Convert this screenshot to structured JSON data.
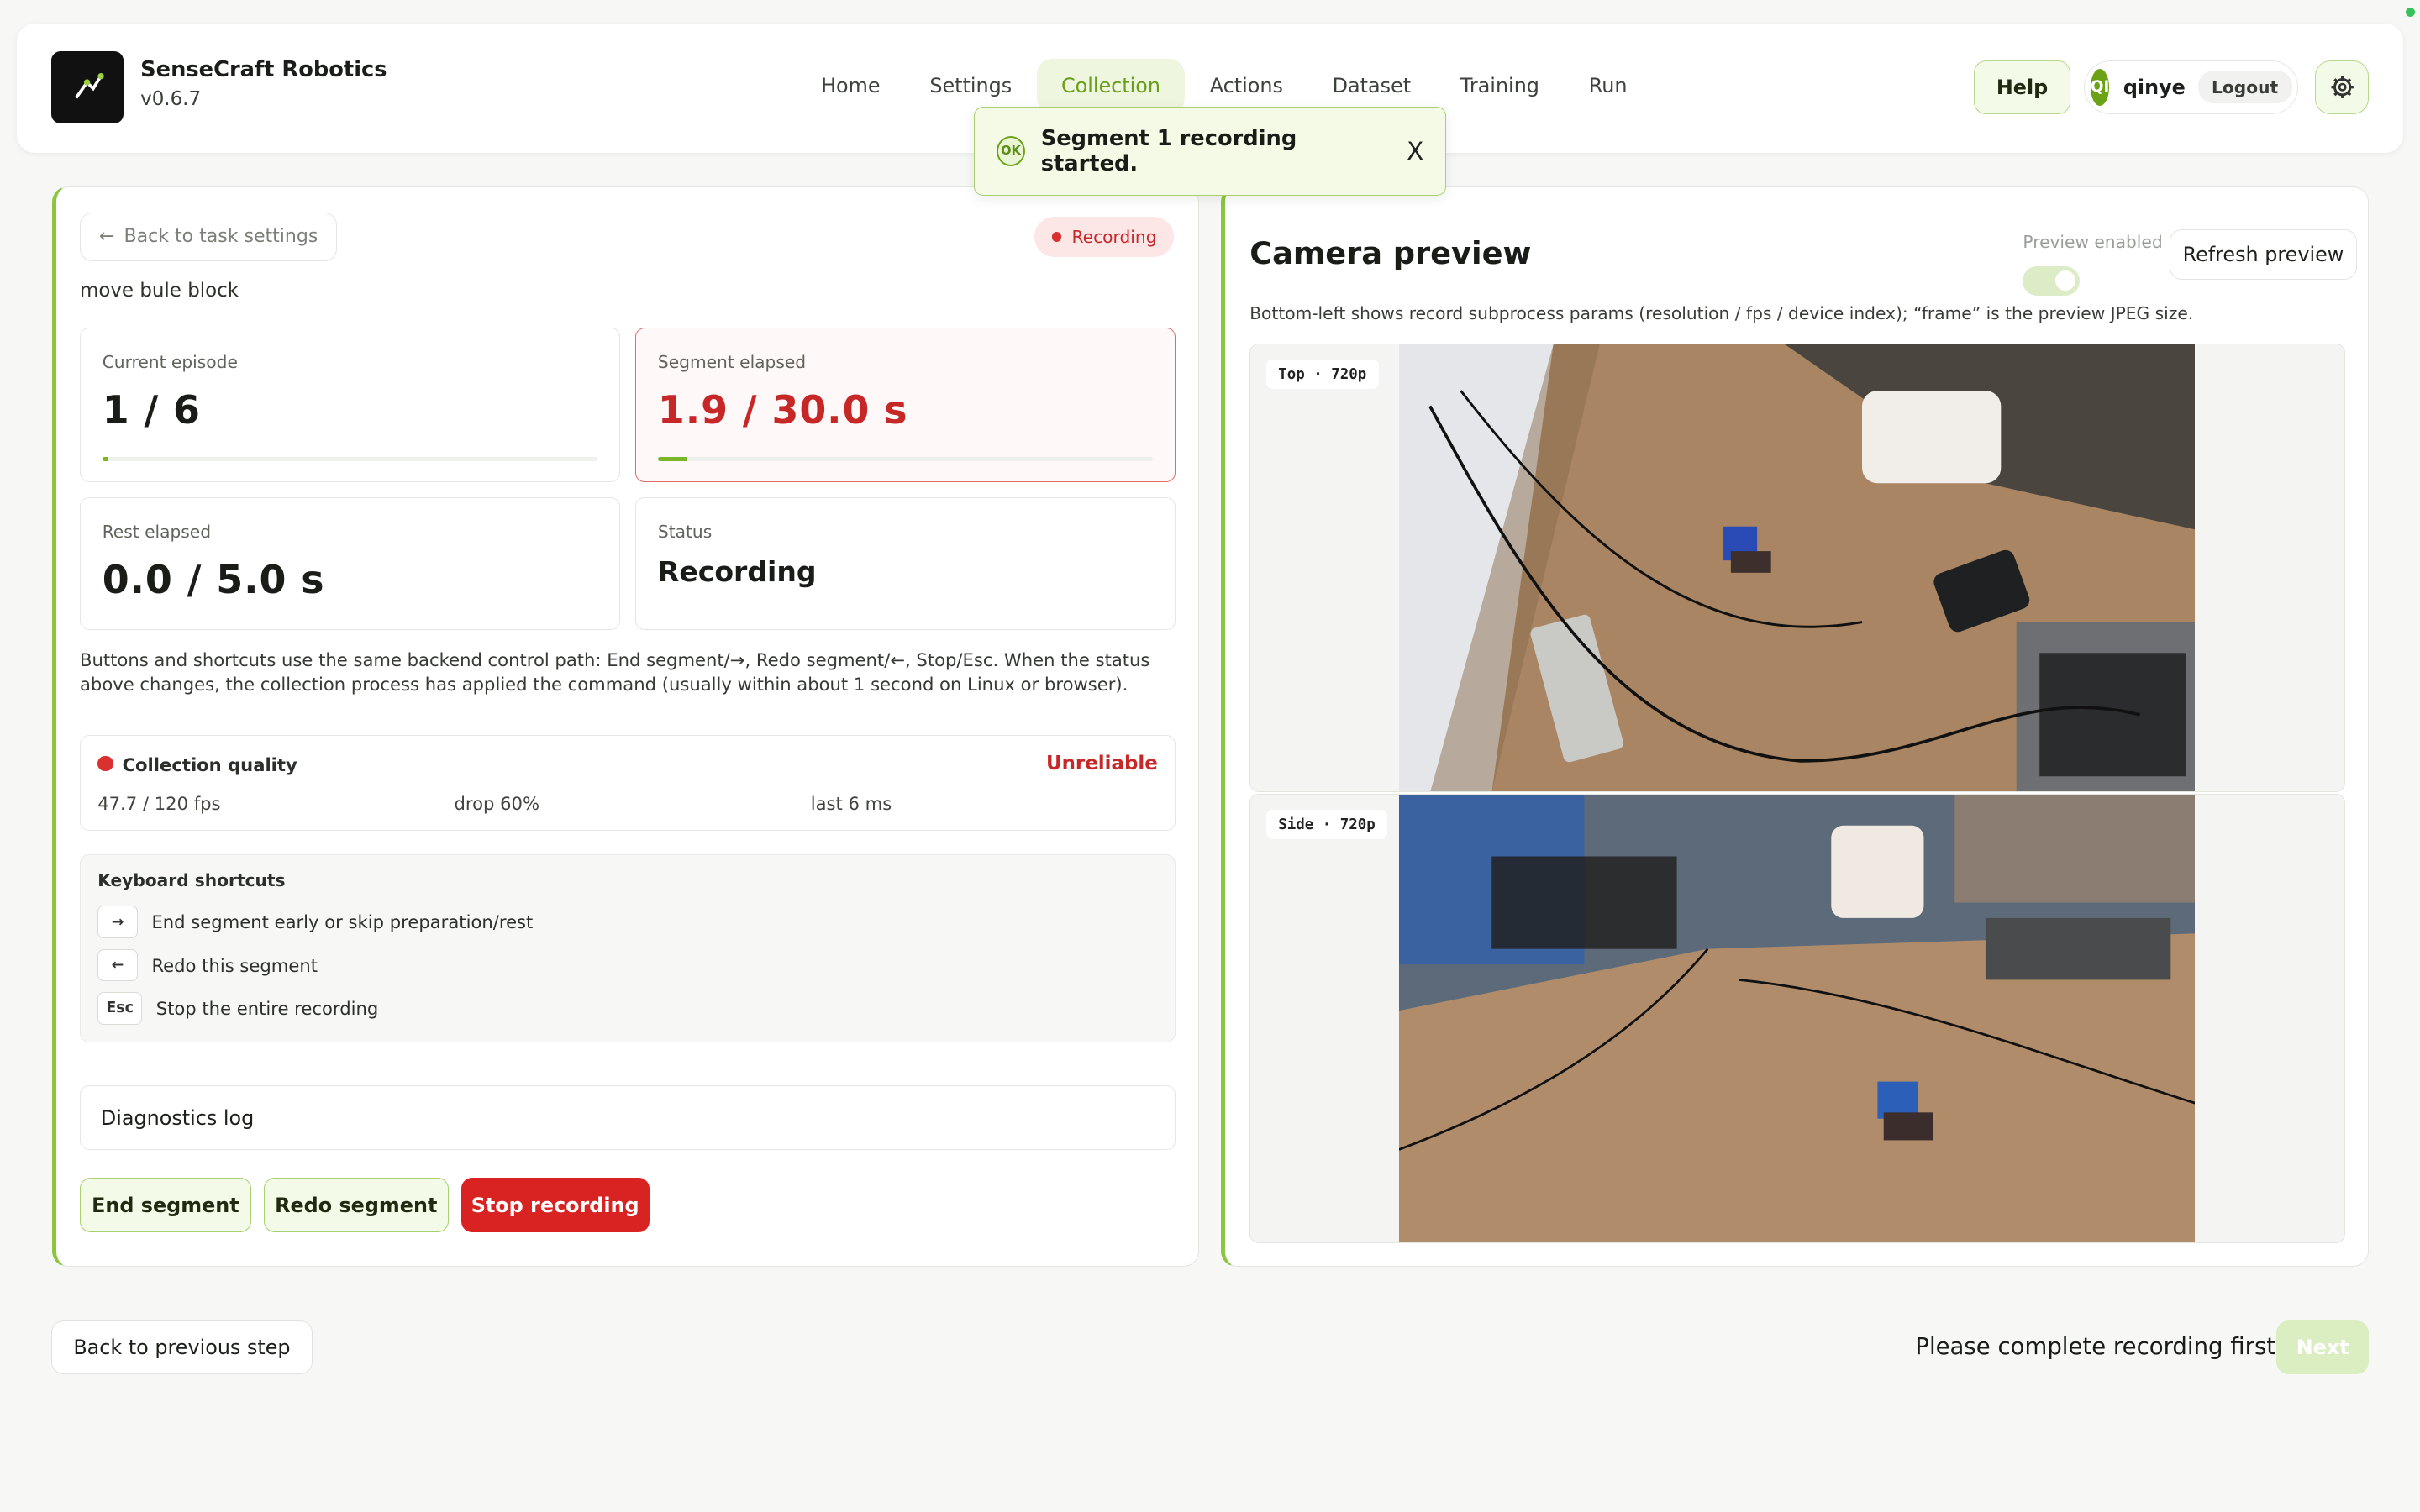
{
  "app": {
    "name": "SenseCraft Robotics",
    "version": "v0.6.7"
  },
  "nav": [
    {
      "label": "Home",
      "active": false
    },
    {
      "label": "Settings",
      "active": false
    },
    {
      "label": "Collection",
      "active": true
    },
    {
      "label": "Actions",
      "active": false
    },
    {
      "label": "Dataset",
      "active": false
    },
    {
      "label": "Training",
      "active": false
    },
    {
      "label": "Run",
      "active": false
    }
  ],
  "header": {
    "help_label": "Help",
    "avatar_initials": "QI",
    "username": "qinye",
    "logout_label": "Logout"
  },
  "toast": {
    "ok_label": "OK",
    "message": "Segment 1 recording started.",
    "close": "X"
  },
  "recording": {
    "back_label": "Back to task settings",
    "badge": "Recording",
    "task_name": "move bule block",
    "current_episode": {
      "label": "Current episode",
      "value": "1 / 6",
      "progress": 0.01
    },
    "segment_elapsed": {
      "label": "Segment elapsed",
      "value": "1.9 / 30.0 s",
      "progress": 0.06
    },
    "rest_elapsed": {
      "label": "Rest elapsed",
      "value": "0.0 / 5.0 s"
    },
    "status": {
      "label": "Status",
      "value": "Recording"
    },
    "help_text": "Buttons and shortcuts use the same backend control path: End segment/→, Redo segment/←, Stop/Esc. When the status above changes, the collection process has applied the command (usually within about 1 second on Linux or browser).",
    "quality": {
      "title": "Collection quality",
      "state": "Unreliable",
      "fps": "47.7 / 120 fps",
      "drop": "drop 60%",
      "last": "last 6 ms"
    },
    "shortcuts": {
      "title": "Keyboard shortcuts",
      "items": [
        {
          "key": "→",
          "desc": "End segment early or skip preparation/rest"
        },
        {
          "key": "←",
          "desc": "Redo this segment"
        },
        {
          "key": "Esc",
          "desc": "Stop the entire recording"
        }
      ]
    },
    "diagnostics_label": "Diagnostics log",
    "buttons": {
      "end": "End segment",
      "redo": "Redo segment",
      "stop": "Stop recording"
    }
  },
  "camera": {
    "title": "Camera preview",
    "preview_enabled_label": "Preview enabled",
    "preview_enabled": true,
    "refresh_label": "Refresh preview",
    "help": "Bottom-left shows record subprocess params (resolution / fps / device index); “frame” is the preview JPEG size.",
    "views": [
      {
        "tag": "Top · 720p"
      },
      {
        "tag": "Side · 720p"
      }
    ]
  },
  "footer": {
    "back_label": "Back to previous step",
    "message": "Please complete recording first.",
    "next_label": "Next"
  },
  "colors": {
    "accent": "#8cc63f",
    "danger": "#d92323",
    "recording_red": "#c62828"
  }
}
